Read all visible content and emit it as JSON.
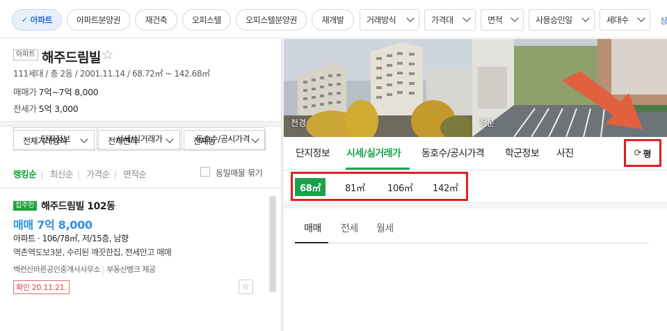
{
  "topbar": {
    "chips": [
      {
        "label": "아파트",
        "active": true
      },
      {
        "label": "아파트분양권"
      },
      {
        "label": "재건축"
      },
      {
        "label": "오피스텔"
      },
      {
        "label": "오피스텔분양권"
      },
      {
        "label": "재개발"
      }
    ],
    "check_mark": "✓",
    "selects": [
      "거래방식",
      "가격대",
      "면적",
      "사용승인일",
      "세대수"
    ],
    "more_label": "상"
  },
  "complex": {
    "type_badge": "아파트",
    "name": "해주드림빌",
    "star": "☆",
    "meta": "111세대 / 총 2동 / 2001.11.14 / 68.72㎡ ~ 142.68㎡",
    "sale_label": "매매가",
    "sale_value": "7억~7억 8,000",
    "jeonse_label": "전세가",
    "jeonse_value": "5억 3,000",
    "tabs": [
      "단지정보",
      "시세/실거래가",
      "동호수/공시가격"
    ]
  },
  "filters": {
    "deal_type": "전체거래방식",
    "area": "전체면적",
    "dong": "전체동"
  },
  "sort": {
    "options": [
      "랭킹순",
      "최신순",
      "가격순",
      "면적순"
    ],
    "bar": "|",
    "same_listing_label": "동일매물 묶기"
  },
  "listing": {
    "owner_badge": "집주인",
    "title": "해주드림빌 102동",
    "price": "매매 7억 8,000",
    "spec": "아파트 · 106/78㎡, 저/15층, 남향",
    "desc": "역촌역도보3분, 수리된 깨끗한집, 전세안고 매매",
    "agent": "백련산바른공인중개사사무소",
    "agent_bar": "|",
    "provider": "부동산뱅크 제공",
    "confirm": "확인 20.11.21.",
    "fav_icon": "☆"
  },
  "photos": [
    {
      "label": "전경"
    },
    {
      "label": "정문"
    }
  ],
  "detail_tabs": {
    "items": [
      "단지정보",
      "시세/실거래가",
      "동호수/공시가격",
      "학군정보",
      "사진"
    ],
    "active": "시세/실거래가",
    "unit_icon": "⟳",
    "unit_label": "평"
  },
  "sizes": {
    "items": [
      "68㎡",
      "81㎡",
      "106㎡",
      "142㎡"
    ],
    "active": "68㎡"
  },
  "deal_tabs": {
    "items": [
      "매매",
      "전세",
      "월세"
    ],
    "active": "매매"
  },
  "colors": {
    "accent_green": "#17a34a",
    "highlight_red": "#e01e1e",
    "price_blue": "#2b8fe0",
    "arrow_orange": "#e2603d"
  }
}
